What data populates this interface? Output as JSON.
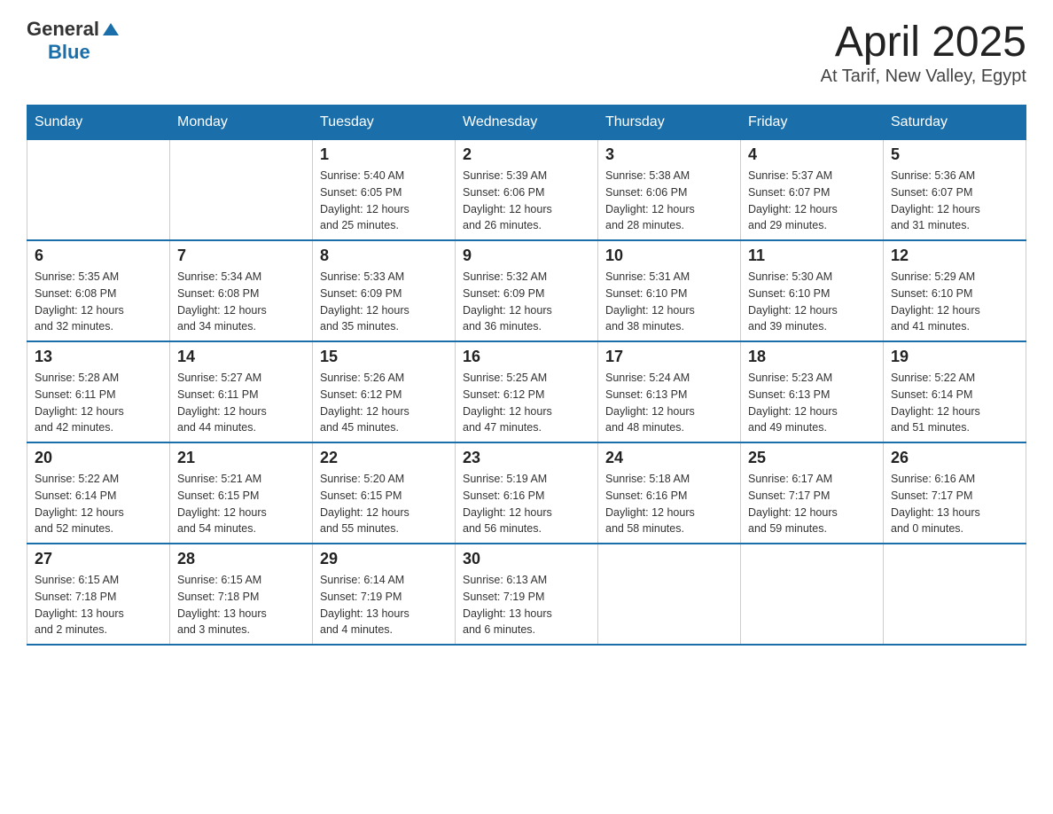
{
  "header": {
    "logo": {
      "general": "General",
      "blue": "Blue"
    },
    "title": "April 2025",
    "subtitle": "At Tarif, New Valley, Egypt"
  },
  "calendar": {
    "weekdays": [
      "Sunday",
      "Monday",
      "Tuesday",
      "Wednesday",
      "Thursday",
      "Friday",
      "Saturday"
    ],
    "weeks": [
      [
        {
          "day": null,
          "info": null
        },
        {
          "day": null,
          "info": null
        },
        {
          "day": "1",
          "info": "Sunrise: 5:40 AM\nSunset: 6:05 PM\nDaylight: 12 hours\nand 25 minutes."
        },
        {
          "day": "2",
          "info": "Sunrise: 5:39 AM\nSunset: 6:06 PM\nDaylight: 12 hours\nand 26 minutes."
        },
        {
          "day": "3",
          "info": "Sunrise: 5:38 AM\nSunset: 6:06 PM\nDaylight: 12 hours\nand 28 minutes."
        },
        {
          "day": "4",
          "info": "Sunrise: 5:37 AM\nSunset: 6:07 PM\nDaylight: 12 hours\nand 29 minutes."
        },
        {
          "day": "5",
          "info": "Sunrise: 5:36 AM\nSunset: 6:07 PM\nDaylight: 12 hours\nand 31 minutes."
        }
      ],
      [
        {
          "day": "6",
          "info": "Sunrise: 5:35 AM\nSunset: 6:08 PM\nDaylight: 12 hours\nand 32 minutes."
        },
        {
          "day": "7",
          "info": "Sunrise: 5:34 AM\nSunset: 6:08 PM\nDaylight: 12 hours\nand 34 minutes."
        },
        {
          "day": "8",
          "info": "Sunrise: 5:33 AM\nSunset: 6:09 PM\nDaylight: 12 hours\nand 35 minutes."
        },
        {
          "day": "9",
          "info": "Sunrise: 5:32 AM\nSunset: 6:09 PM\nDaylight: 12 hours\nand 36 minutes."
        },
        {
          "day": "10",
          "info": "Sunrise: 5:31 AM\nSunset: 6:10 PM\nDaylight: 12 hours\nand 38 minutes."
        },
        {
          "day": "11",
          "info": "Sunrise: 5:30 AM\nSunset: 6:10 PM\nDaylight: 12 hours\nand 39 minutes."
        },
        {
          "day": "12",
          "info": "Sunrise: 5:29 AM\nSunset: 6:10 PM\nDaylight: 12 hours\nand 41 minutes."
        }
      ],
      [
        {
          "day": "13",
          "info": "Sunrise: 5:28 AM\nSunset: 6:11 PM\nDaylight: 12 hours\nand 42 minutes."
        },
        {
          "day": "14",
          "info": "Sunrise: 5:27 AM\nSunset: 6:11 PM\nDaylight: 12 hours\nand 44 minutes."
        },
        {
          "day": "15",
          "info": "Sunrise: 5:26 AM\nSunset: 6:12 PM\nDaylight: 12 hours\nand 45 minutes."
        },
        {
          "day": "16",
          "info": "Sunrise: 5:25 AM\nSunset: 6:12 PM\nDaylight: 12 hours\nand 47 minutes."
        },
        {
          "day": "17",
          "info": "Sunrise: 5:24 AM\nSunset: 6:13 PM\nDaylight: 12 hours\nand 48 minutes."
        },
        {
          "day": "18",
          "info": "Sunrise: 5:23 AM\nSunset: 6:13 PM\nDaylight: 12 hours\nand 49 minutes."
        },
        {
          "day": "19",
          "info": "Sunrise: 5:22 AM\nSunset: 6:14 PM\nDaylight: 12 hours\nand 51 minutes."
        }
      ],
      [
        {
          "day": "20",
          "info": "Sunrise: 5:22 AM\nSunset: 6:14 PM\nDaylight: 12 hours\nand 52 minutes."
        },
        {
          "day": "21",
          "info": "Sunrise: 5:21 AM\nSunset: 6:15 PM\nDaylight: 12 hours\nand 54 minutes."
        },
        {
          "day": "22",
          "info": "Sunrise: 5:20 AM\nSunset: 6:15 PM\nDaylight: 12 hours\nand 55 minutes."
        },
        {
          "day": "23",
          "info": "Sunrise: 5:19 AM\nSunset: 6:16 PM\nDaylight: 12 hours\nand 56 minutes."
        },
        {
          "day": "24",
          "info": "Sunrise: 5:18 AM\nSunset: 6:16 PM\nDaylight: 12 hours\nand 58 minutes."
        },
        {
          "day": "25",
          "info": "Sunrise: 6:17 AM\nSunset: 7:17 PM\nDaylight: 12 hours\nand 59 minutes."
        },
        {
          "day": "26",
          "info": "Sunrise: 6:16 AM\nSunset: 7:17 PM\nDaylight: 13 hours\nand 0 minutes."
        }
      ],
      [
        {
          "day": "27",
          "info": "Sunrise: 6:15 AM\nSunset: 7:18 PM\nDaylight: 13 hours\nand 2 minutes."
        },
        {
          "day": "28",
          "info": "Sunrise: 6:15 AM\nSunset: 7:18 PM\nDaylight: 13 hours\nand 3 minutes."
        },
        {
          "day": "29",
          "info": "Sunrise: 6:14 AM\nSunset: 7:19 PM\nDaylight: 13 hours\nand 4 minutes."
        },
        {
          "day": "30",
          "info": "Sunrise: 6:13 AM\nSunset: 7:19 PM\nDaylight: 13 hours\nand 6 minutes."
        },
        {
          "day": null,
          "info": null
        },
        {
          "day": null,
          "info": null
        },
        {
          "day": null,
          "info": null
        }
      ]
    ]
  }
}
